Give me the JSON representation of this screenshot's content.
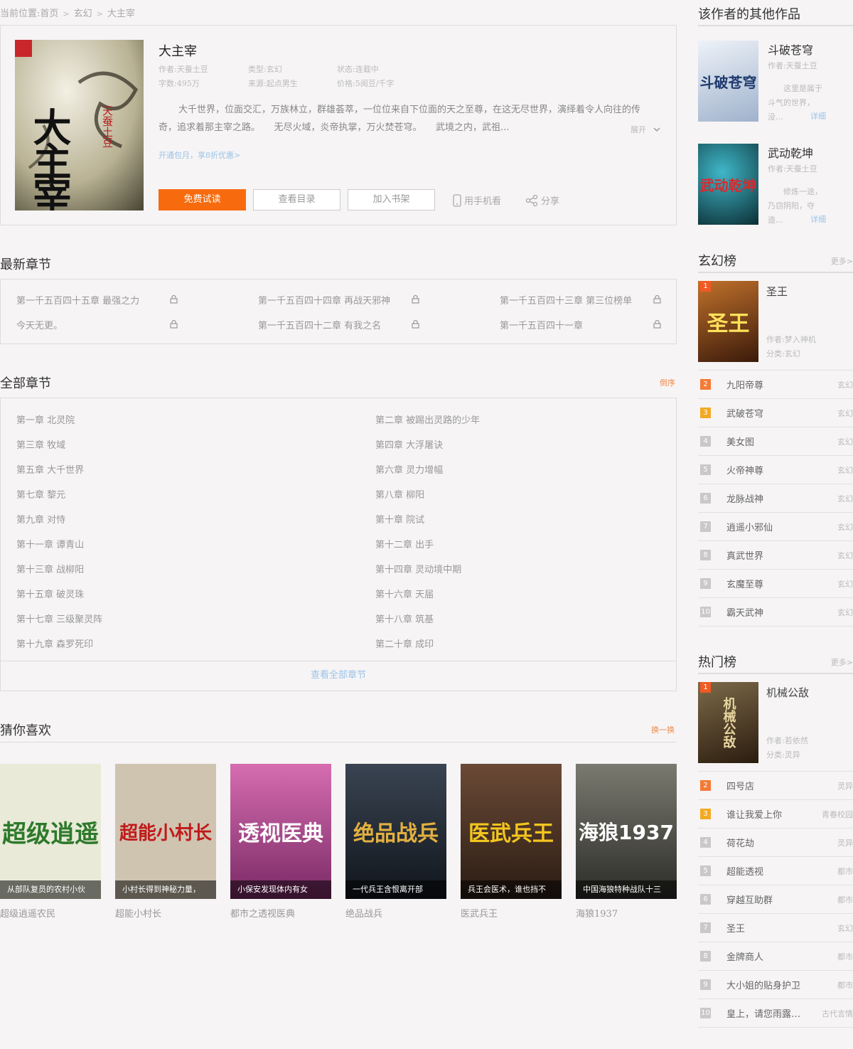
{
  "breadcrumb": {
    "prefix": "当前位置:",
    "items": [
      "首页",
      "玄幻",
      "大主宰"
    ],
    "sep": ">"
  },
  "book": {
    "title": "大主宰",
    "cover_text": "大主宰",
    "cover_author": "天蚕土豆",
    "meta": {
      "author": "作者:天蚕土豆",
      "type": "类型:玄幻",
      "status": "状态:连载中",
      "words": "字数:495万",
      "source": "来源:起点男生",
      "price": "价格:5阅豆/千字"
    },
    "intro": "大千世界，位面交汇，万族林立，群雄荟萃，一位位来自下位面的天之至尊，在这无尽世界，演绎着令人向往的传奇，追求着那主宰之路。　　无尽火域，炎帝执掌，万火焚苍穹。　　武境之内，武祖...",
    "expand": "展开",
    "vip_link": "开通包月，享8折优惠>",
    "buttons": {
      "read": "免费试读",
      "catalog": "查看目录",
      "shelf": "加入书架"
    },
    "actions": {
      "mobile": "用手机看",
      "share": "分享"
    }
  },
  "latest": {
    "title": "最新章节",
    "items": [
      "第一千五百四十五章 最强之力",
      "第一千五百四十四章 再战天邪神",
      "第一千五百四十三章 第三位榜单",
      "今天无更。",
      "第一千五百四十二章 有我之名",
      "第一千五百四十一章"
    ]
  },
  "all": {
    "title": "全部章节",
    "order": "倒序",
    "chapters": [
      "第一章 北灵院",
      "第二章 被踢出灵路的少年",
      "第三章 牧域",
      "第四章 大浮屠诀",
      "第五章 大千世界",
      "第六章 灵力增幅",
      "第七章 黎元",
      "第八章 柳阳",
      "第九章 对恃",
      "第十章 院试",
      "第十一章 谭青山",
      "第十二章 出手",
      "第十三章 战柳阳",
      "第十四章 灵动境中期",
      "第十五章 破灵珠",
      "第十六章 天届",
      "第十七章 三级聚灵阵",
      "第十八章 筑基",
      "第十九章 森罗死印",
      "第二十章 成印"
    ],
    "view_all": "查看全部章节"
  },
  "guess": {
    "title": "猜你喜欢",
    "refresh": "换一换",
    "books": [
      {
        "title": "超级逍遥农民",
        "caption": "从部队复员的农村小伙",
        "cover": "超级逍遥",
        "bg": "#e9ead8",
        "fg": "#2d7a2b"
      },
      {
        "title": "超能小村长",
        "caption": "小村长得到神秘力量，",
        "cover": "超能小村长",
        "bg": "#cfc4b0",
        "fg": "#c01a1a"
      },
      {
        "title": "都市之透视医典",
        "caption": "小保安发现体内有女",
        "cover": "透视医典",
        "bg": "#b8478f",
        "fg": "#ffffff"
      },
      {
        "title": "绝品战兵",
        "caption": "一代兵王含恨离开部",
        "cover": "绝品战兵",
        "bg": "#1d2530",
        "fg": "#e2b040"
      },
      {
        "title": "医武兵王",
        "caption": "兵王会医术，谁也挡不",
        "cover": "医武兵王",
        "bg": "#3a2b22",
        "fg": "#f3c61f"
      },
      {
        "title": "海狼1937",
        "caption": "中国海狼特种战队十三",
        "cover": "海狼1937",
        "bg": "#4a4a44",
        "fg": "#ffffff"
      }
    ]
  },
  "sidebar": {
    "other_title": "该作者的其他作品",
    "other_works": [
      {
        "title": "斗破苍穹",
        "author": "作者:天蚕土豆",
        "desc": "这里是属于斗气的世界，没...",
        "detail": "详细",
        "cover": "斗破苍穹",
        "bg": "#dbe3ef",
        "fg": "#1e3a6e"
      },
      {
        "title": "武动乾坤",
        "author": "作者:天蚕土豆",
        "desc": "修炼一途，乃窃阴阳，夺造...",
        "detail": "详细",
        "cover": "武动乾坤",
        "bg": "#0f3b44",
        "fg": "#c8262b"
      }
    ],
    "xuanhuan": {
      "title": "玄幻榜",
      "more": "更多>",
      "top": {
        "title": "圣王",
        "author": "作者:梦入神机",
        "category": "分类:玄幻",
        "cover": "圣王",
        "bg": "#7a3b16",
        "fg": "#ffe25a"
      },
      "rows": [
        {
          "rank": "2",
          "title": "九阳帝尊",
          "cat": "玄幻"
        },
        {
          "rank": "3",
          "title": "武破苍穹",
          "cat": "玄幻"
        },
        {
          "rank": "4",
          "title": "美女图",
          "cat": "玄幻"
        },
        {
          "rank": "5",
          "title": "火帝神尊",
          "cat": "玄幻"
        },
        {
          "rank": "6",
          "title": "龙脉战神",
          "cat": "玄幻"
        },
        {
          "rank": "7",
          "title": "逍遥小邪仙",
          "cat": "玄幻"
        },
        {
          "rank": "8",
          "title": "真武世界",
          "cat": "玄幻"
        },
        {
          "rank": "9",
          "title": "玄魔至尊",
          "cat": "玄幻"
        },
        {
          "rank": "10",
          "title": "霸天武神",
          "cat": "玄幻"
        }
      ]
    },
    "hot": {
      "title": "热门榜",
      "more": "更多>",
      "top": {
        "title": "机械公敌",
        "author": "作者:若依然",
        "category": "分类:灵异",
        "cover": "机械公敌",
        "bg": "#4a3b28",
        "fg": "#e8d6a0"
      },
      "rows": [
        {
          "rank": "2",
          "title": "四号店",
          "cat": "灵异"
        },
        {
          "rank": "3",
          "title": "谁让我爱上你",
          "cat": "青春校园"
        },
        {
          "rank": "4",
          "title": "荷花劫",
          "cat": "灵异"
        },
        {
          "rank": "5",
          "title": "超能透视",
          "cat": "都市"
        },
        {
          "rank": "6",
          "title": "穿越互助群",
          "cat": "都市"
        },
        {
          "rank": "7",
          "title": "圣王",
          "cat": "玄幻"
        },
        {
          "rank": "8",
          "title": "金牌商人",
          "cat": "都市"
        },
        {
          "rank": "9",
          "title": "大小姐的贴身护卫",
          "cat": "都市"
        },
        {
          "rank": "10",
          "title": "皇上，请您雨露…",
          "cat": "古代言情"
        }
      ]
    }
  }
}
